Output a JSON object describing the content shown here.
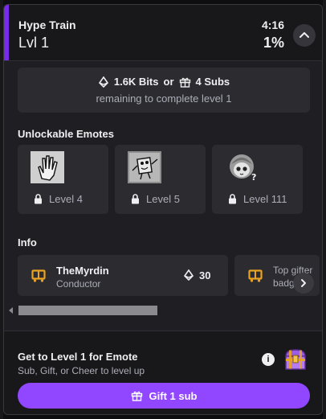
{
  "header": {
    "title": "Hype Train",
    "level": "Lvl 1",
    "time_remaining": "4:16",
    "progress": "1%"
  },
  "goal": {
    "bits": "1.6K Bits",
    "or": "or",
    "subs": "4 Subs",
    "remaining_text": "remaining to complete level 1"
  },
  "emotes": {
    "title": "Unlockable Emotes",
    "items": [
      {
        "level": "Level 4",
        "icon": "waving-hand-emote"
      },
      {
        "level": "Level 5",
        "icon": "sponge-dance-emote"
      },
      {
        "level": "Level 111",
        "icon": "anime-girl-emote"
      }
    ]
  },
  "info": {
    "title": "Info",
    "cards": [
      {
        "name": "TheMyrdin",
        "role": "Conductor",
        "bits": "30",
        "icon": "train-icon"
      },
      {
        "line1": "Top gifter",
        "line2": "badge",
        "icon": "train-icon"
      }
    ]
  },
  "footer": {
    "title": "Get to Level 1 for Emote",
    "subtitle": "Sub, Gift, or Cheer to level up",
    "gift_button": "Gift 1 sub"
  },
  "colors": {
    "accent": "#772ce8",
    "button": "#9147ff",
    "train": "#e8a322"
  }
}
